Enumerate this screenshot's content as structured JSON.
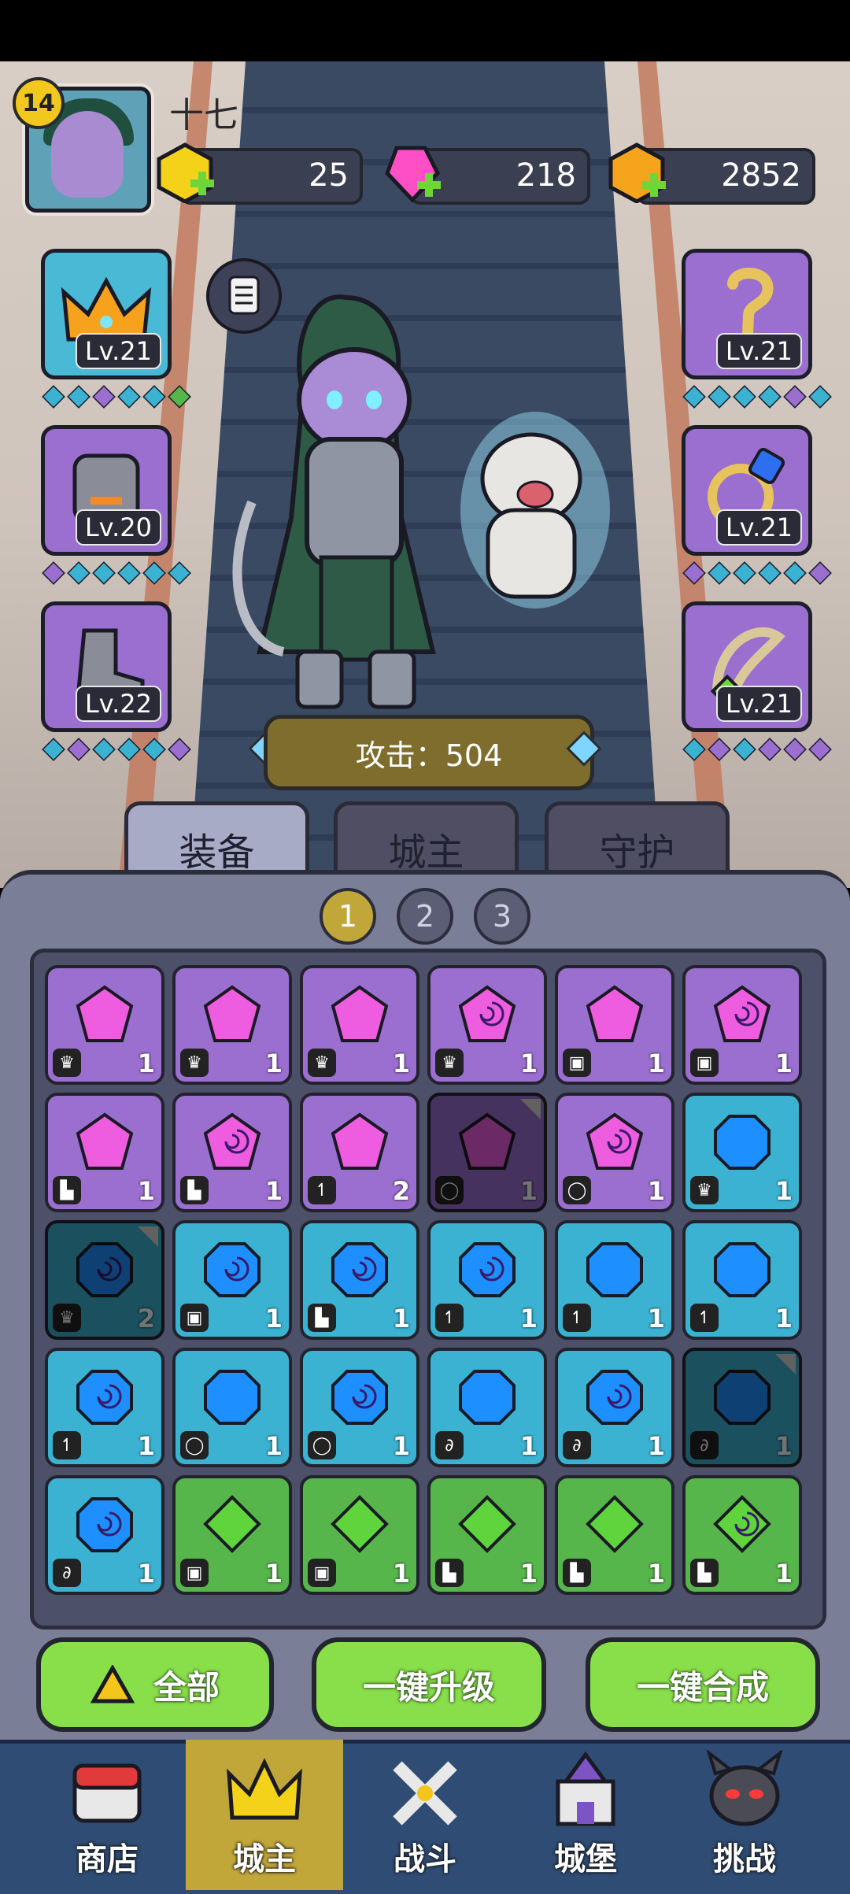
{
  "player": {
    "level": "14",
    "name": "十七"
  },
  "currencies": [
    {
      "name": "energy",
      "value": "25",
      "color": "#f4d21a"
    },
    {
      "name": "gem",
      "value": "218",
      "color": "#ff4fc6"
    },
    {
      "name": "gold",
      "value": "2852",
      "color": "#f6a41c"
    }
  ],
  "equipment_left": [
    {
      "slot": "crown",
      "level": "Lv.21"
    },
    {
      "slot": "armor",
      "level": "Lv.20"
    },
    {
      "slot": "boots",
      "level": "Lv.22"
    }
  ],
  "equipment_right": [
    {
      "slot": "staff",
      "level": "Lv.21"
    },
    {
      "slot": "ring",
      "level": "Lv.21"
    },
    {
      "slot": "amulet",
      "level": "Lv.21"
    }
  ],
  "attack": "攻击：504",
  "tabs": [
    "装备",
    "城主",
    "守护"
  ],
  "pages": [
    "1",
    "2",
    "3"
  ],
  "inventory": [
    {
      "color": "purple",
      "type": "crown",
      "count": "1",
      "swirl": false
    },
    {
      "color": "purple",
      "type": "crown",
      "count": "1",
      "swirl": false
    },
    {
      "color": "purple",
      "type": "crown",
      "count": "1",
      "swirl": false
    },
    {
      "color": "purple",
      "type": "crown",
      "count": "1",
      "swirl": true
    },
    {
      "color": "purple",
      "type": "armor",
      "count": "1",
      "swirl": false
    },
    {
      "color": "purple",
      "type": "armor",
      "count": "1",
      "swirl": true
    },
    {
      "color": "purple",
      "type": "boots",
      "count": "1",
      "swirl": false
    },
    {
      "color": "purple",
      "type": "boots",
      "count": "1",
      "swirl": true
    },
    {
      "color": "purple",
      "type": "staff",
      "count": "2",
      "swirl": false
    },
    {
      "color": "purple",
      "type": "ring",
      "count": "1",
      "swirl": false,
      "locked": true
    },
    {
      "color": "purple",
      "type": "ring",
      "count": "1",
      "swirl": true
    },
    {
      "color": "blue",
      "type": "crown",
      "count": "1",
      "swirl": false
    },
    {
      "color": "blue",
      "type": "crown",
      "count": "2",
      "swirl": true,
      "locked": true
    },
    {
      "color": "blue",
      "type": "armor",
      "count": "1",
      "swirl": true
    },
    {
      "color": "blue",
      "type": "boots",
      "count": "1",
      "swirl": true
    },
    {
      "color": "blue",
      "type": "staff",
      "count": "1",
      "swirl": true
    },
    {
      "color": "blue",
      "type": "staff",
      "count": "1",
      "swirl": false
    },
    {
      "color": "blue",
      "type": "staff",
      "count": "1",
      "swirl": false
    },
    {
      "color": "blue",
      "type": "staff",
      "count": "1",
      "swirl": true
    },
    {
      "color": "blue",
      "type": "ring",
      "count": "1",
      "swirl": false
    },
    {
      "color": "blue",
      "type": "ring",
      "count": "1",
      "swirl": true
    },
    {
      "color": "blue",
      "type": "amulet",
      "count": "1",
      "swirl": false
    },
    {
      "color": "blue",
      "type": "amulet",
      "count": "1",
      "swirl": true
    },
    {
      "color": "blue",
      "type": "amulet",
      "count": "1",
      "swirl": false,
      "locked": true
    },
    {
      "color": "blue",
      "type": "amulet",
      "count": "1",
      "swirl": true
    },
    {
      "color": "green",
      "type": "armor",
      "count": "1",
      "swirl": false
    },
    {
      "color": "green",
      "type": "armor",
      "count": "1",
      "swirl": false
    },
    {
      "color": "green",
      "type": "boots",
      "count": "1",
      "swirl": false
    },
    {
      "color": "green",
      "type": "boots",
      "count": "1",
      "swirl": false
    },
    {
      "color": "green",
      "type": "boots",
      "count": "1",
      "swirl": true
    }
  ],
  "actions": {
    "all": "全部",
    "upgrade": "一键升级",
    "merge": "一键合成"
  },
  "nav": [
    "商店",
    "城主",
    "战斗",
    "城堡",
    "挑战"
  ],
  "colors": {
    "purple": "#9b6fd0",
    "blue": "#3bb2d2",
    "green": "#56b54b",
    "accent": "#c1a63a"
  }
}
